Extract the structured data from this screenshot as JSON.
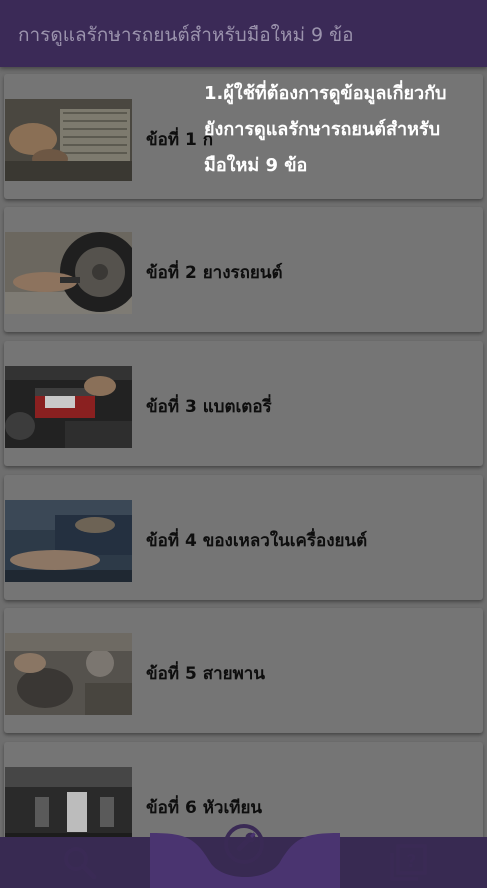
{
  "appbar": {
    "title": "การดูแลรักษารถยนต์สำหรับมือใหม่ 9 ข้อ"
  },
  "tooltip": {
    "lines": [
      "1.ผู้ใช้ที่ต้องการดูข้อมูลเกี่ยวกับ",
      "ยังการดูแลรักษารถยนต์สำหรับ",
      "มือใหม่ 9 ข้อ"
    ]
  },
  "items": [
    {
      "label": "ข้อที่ 1 ก",
      "thumb": "air-filter-photo"
    },
    {
      "label": "ข้อที่ 2 ยางรถยนต์",
      "thumb": "tire-photo"
    },
    {
      "label": "ข้อที่ 3 แบตเตอรี่",
      "thumb": "battery-photo"
    },
    {
      "label": "ข้อที่ 4 ของเหลวในเครื่องยนต์",
      "thumb": "engine-fluid-photo"
    },
    {
      "label": "ข้อที่ 5 สายพาน",
      "thumb": "belt-photo"
    },
    {
      "label": "ข้อที่ 6 หัวเทียน",
      "thumb": "spark-plug-photo"
    }
  ],
  "bottom_nav": {
    "left": "search-icon",
    "center": "wrench-icon",
    "right": "help-pages-icon"
  },
  "colors": {
    "appbar": "#3b2a57",
    "bottombar": "#382a52",
    "center_tab": "#4a3470",
    "icon": "#3a2a55",
    "overlay_text": "#ffffff"
  }
}
